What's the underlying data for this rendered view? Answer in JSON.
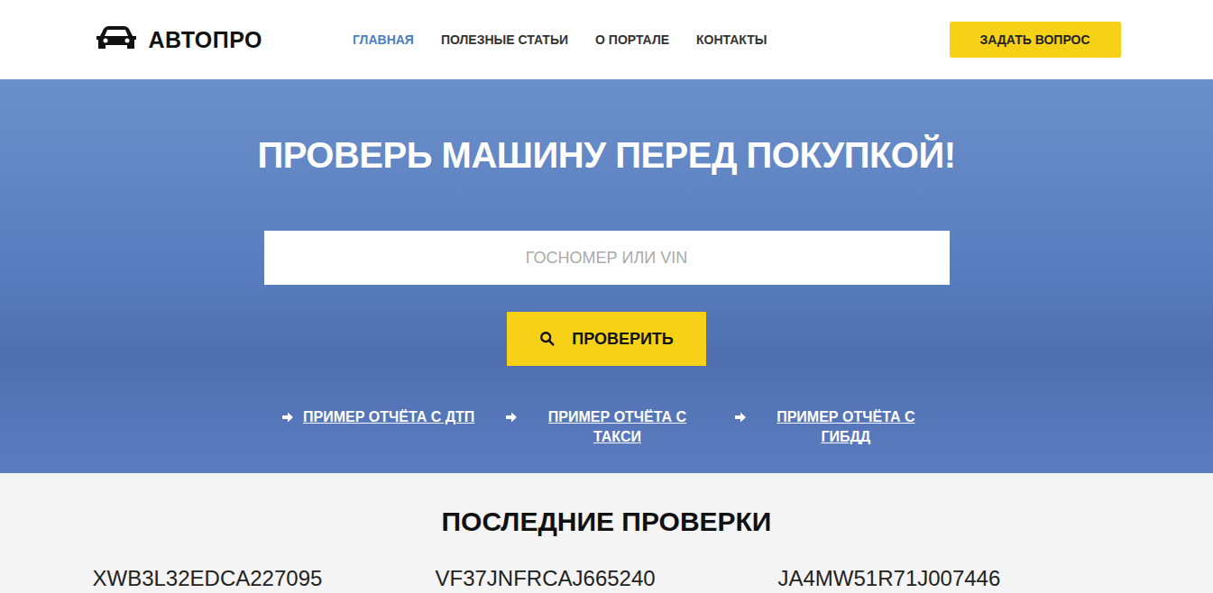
{
  "header": {
    "logo": "АВТОПРО",
    "nav": [
      {
        "label": "ГЛАВНАЯ",
        "selected": true
      },
      {
        "label": "ПОЛЕЗНЫЕ СТАТЬИ",
        "selected": false
      },
      {
        "label": "О ПОРТАЛЕ",
        "selected": false
      },
      {
        "label": "КОНТАКТЫ",
        "selected": false
      }
    ],
    "ask_button": "ЗАДАТЬ ВОПРОС"
  },
  "hero": {
    "title": "ПРОВЕРЬ МАШИНУ ПЕРЕД ПОКУПКОЙ!",
    "search": {
      "placeholder": "ГОСНОМЕР ИЛИ VIN"
    },
    "check_button": "ПРОВЕРИТЬ",
    "example_links": [
      "ПРИМЕР ОТЧЁТА С ДТП",
      "ПРИМЕР ОТЧЁТА С ТАКСИ",
      "ПРИМЕР ОТЧЁТА С ГИБДД"
    ]
  },
  "recent": {
    "title": "ПОСЛЕДНИЕ ПРОВЕРКИ",
    "items": [
      "XWB3L32EDCA227095",
      "VF37JNFRCAJ665240",
      "JA4MW51R71J007446"
    ]
  }
}
